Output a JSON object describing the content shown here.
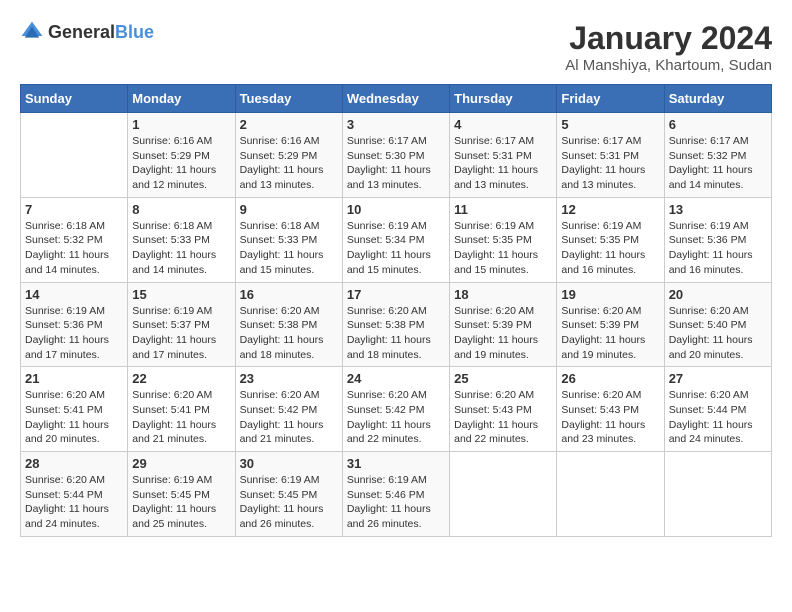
{
  "header": {
    "logo_general": "General",
    "logo_blue": "Blue",
    "month_year": "January 2024",
    "location": "Al Manshiya, Khartoum, Sudan"
  },
  "weekdays": [
    "Sunday",
    "Monday",
    "Tuesday",
    "Wednesday",
    "Thursday",
    "Friday",
    "Saturday"
  ],
  "weeks": [
    [
      {
        "day": "",
        "sunrise": "",
        "sunset": "",
        "daylight": ""
      },
      {
        "day": "1",
        "sunrise": "Sunrise: 6:16 AM",
        "sunset": "Sunset: 5:29 PM",
        "daylight": "Daylight: 11 hours and 12 minutes."
      },
      {
        "day": "2",
        "sunrise": "Sunrise: 6:16 AM",
        "sunset": "Sunset: 5:29 PM",
        "daylight": "Daylight: 11 hours and 13 minutes."
      },
      {
        "day": "3",
        "sunrise": "Sunrise: 6:17 AM",
        "sunset": "Sunset: 5:30 PM",
        "daylight": "Daylight: 11 hours and 13 minutes."
      },
      {
        "day": "4",
        "sunrise": "Sunrise: 6:17 AM",
        "sunset": "Sunset: 5:31 PM",
        "daylight": "Daylight: 11 hours and 13 minutes."
      },
      {
        "day": "5",
        "sunrise": "Sunrise: 6:17 AM",
        "sunset": "Sunset: 5:31 PM",
        "daylight": "Daylight: 11 hours and 13 minutes."
      },
      {
        "day": "6",
        "sunrise": "Sunrise: 6:17 AM",
        "sunset": "Sunset: 5:32 PM",
        "daylight": "Daylight: 11 hours and 14 minutes."
      }
    ],
    [
      {
        "day": "7",
        "sunrise": "Sunrise: 6:18 AM",
        "sunset": "Sunset: 5:32 PM",
        "daylight": "Daylight: 11 hours and 14 minutes."
      },
      {
        "day": "8",
        "sunrise": "Sunrise: 6:18 AM",
        "sunset": "Sunset: 5:33 PM",
        "daylight": "Daylight: 11 hours and 14 minutes."
      },
      {
        "day": "9",
        "sunrise": "Sunrise: 6:18 AM",
        "sunset": "Sunset: 5:33 PM",
        "daylight": "Daylight: 11 hours and 15 minutes."
      },
      {
        "day": "10",
        "sunrise": "Sunrise: 6:19 AM",
        "sunset": "Sunset: 5:34 PM",
        "daylight": "Daylight: 11 hours and 15 minutes."
      },
      {
        "day": "11",
        "sunrise": "Sunrise: 6:19 AM",
        "sunset": "Sunset: 5:35 PM",
        "daylight": "Daylight: 11 hours and 15 minutes."
      },
      {
        "day": "12",
        "sunrise": "Sunrise: 6:19 AM",
        "sunset": "Sunset: 5:35 PM",
        "daylight": "Daylight: 11 hours and 16 minutes."
      },
      {
        "day": "13",
        "sunrise": "Sunrise: 6:19 AM",
        "sunset": "Sunset: 5:36 PM",
        "daylight": "Daylight: 11 hours and 16 minutes."
      }
    ],
    [
      {
        "day": "14",
        "sunrise": "Sunrise: 6:19 AM",
        "sunset": "Sunset: 5:36 PM",
        "daylight": "Daylight: 11 hours and 17 minutes."
      },
      {
        "day": "15",
        "sunrise": "Sunrise: 6:19 AM",
        "sunset": "Sunset: 5:37 PM",
        "daylight": "Daylight: 11 hours and 17 minutes."
      },
      {
        "day": "16",
        "sunrise": "Sunrise: 6:20 AM",
        "sunset": "Sunset: 5:38 PM",
        "daylight": "Daylight: 11 hours and 18 minutes."
      },
      {
        "day": "17",
        "sunrise": "Sunrise: 6:20 AM",
        "sunset": "Sunset: 5:38 PM",
        "daylight": "Daylight: 11 hours and 18 minutes."
      },
      {
        "day": "18",
        "sunrise": "Sunrise: 6:20 AM",
        "sunset": "Sunset: 5:39 PM",
        "daylight": "Daylight: 11 hours and 19 minutes."
      },
      {
        "day": "19",
        "sunrise": "Sunrise: 6:20 AM",
        "sunset": "Sunset: 5:39 PM",
        "daylight": "Daylight: 11 hours and 19 minutes."
      },
      {
        "day": "20",
        "sunrise": "Sunrise: 6:20 AM",
        "sunset": "Sunset: 5:40 PM",
        "daylight": "Daylight: 11 hours and 20 minutes."
      }
    ],
    [
      {
        "day": "21",
        "sunrise": "Sunrise: 6:20 AM",
        "sunset": "Sunset: 5:41 PM",
        "daylight": "Daylight: 11 hours and 20 minutes."
      },
      {
        "day": "22",
        "sunrise": "Sunrise: 6:20 AM",
        "sunset": "Sunset: 5:41 PM",
        "daylight": "Daylight: 11 hours and 21 minutes."
      },
      {
        "day": "23",
        "sunrise": "Sunrise: 6:20 AM",
        "sunset": "Sunset: 5:42 PM",
        "daylight": "Daylight: 11 hours and 21 minutes."
      },
      {
        "day": "24",
        "sunrise": "Sunrise: 6:20 AM",
        "sunset": "Sunset: 5:42 PM",
        "daylight": "Daylight: 11 hours and 22 minutes."
      },
      {
        "day": "25",
        "sunrise": "Sunrise: 6:20 AM",
        "sunset": "Sunset: 5:43 PM",
        "daylight": "Daylight: 11 hours and 22 minutes."
      },
      {
        "day": "26",
        "sunrise": "Sunrise: 6:20 AM",
        "sunset": "Sunset: 5:43 PM",
        "daylight": "Daylight: 11 hours and 23 minutes."
      },
      {
        "day": "27",
        "sunrise": "Sunrise: 6:20 AM",
        "sunset": "Sunset: 5:44 PM",
        "daylight": "Daylight: 11 hours and 24 minutes."
      }
    ],
    [
      {
        "day": "28",
        "sunrise": "Sunrise: 6:20 AM",
        "sunset": "Sunset: 5:44 PM",
        "daylight": "Daylight: 11 hours and 24 minutes."
      },
      {
        "day": "29",
        "sunrise": "Sunrise: 6:19 AM",
        "sunset": "Sunset: 5:45 PM",
        "daylight": "Daylight: 11 hours and 25 minutes."
      },
      {
        "day": "30",
        "sunrise": "Sunrise: 6:19 AM",
        "sunset": "Sunset: 5:45 PM",
        "daylight": "Daylight: 11 hours and 26 minutes."
      },
      {
        "day": "31",
        "sunrise": "Sunrise: 6:19 AM",
        "sunset": "Sunset: 5:46 PM",
        "daylight": "Daylight: 11 hours and 26 minutes."
      },
      {
        "day": "",
        "sunrise": "",
        "sunset": "",
        "daylight": ""
      },
      {
        "day": "",
        "sunrise": "",
        "sunset": "",
        "daylight": ""
      },
      {
        "day": "",
        "sunrise": "",
        "sunset": "",
        "daylight": ""
      }
    ]
  ]
}
